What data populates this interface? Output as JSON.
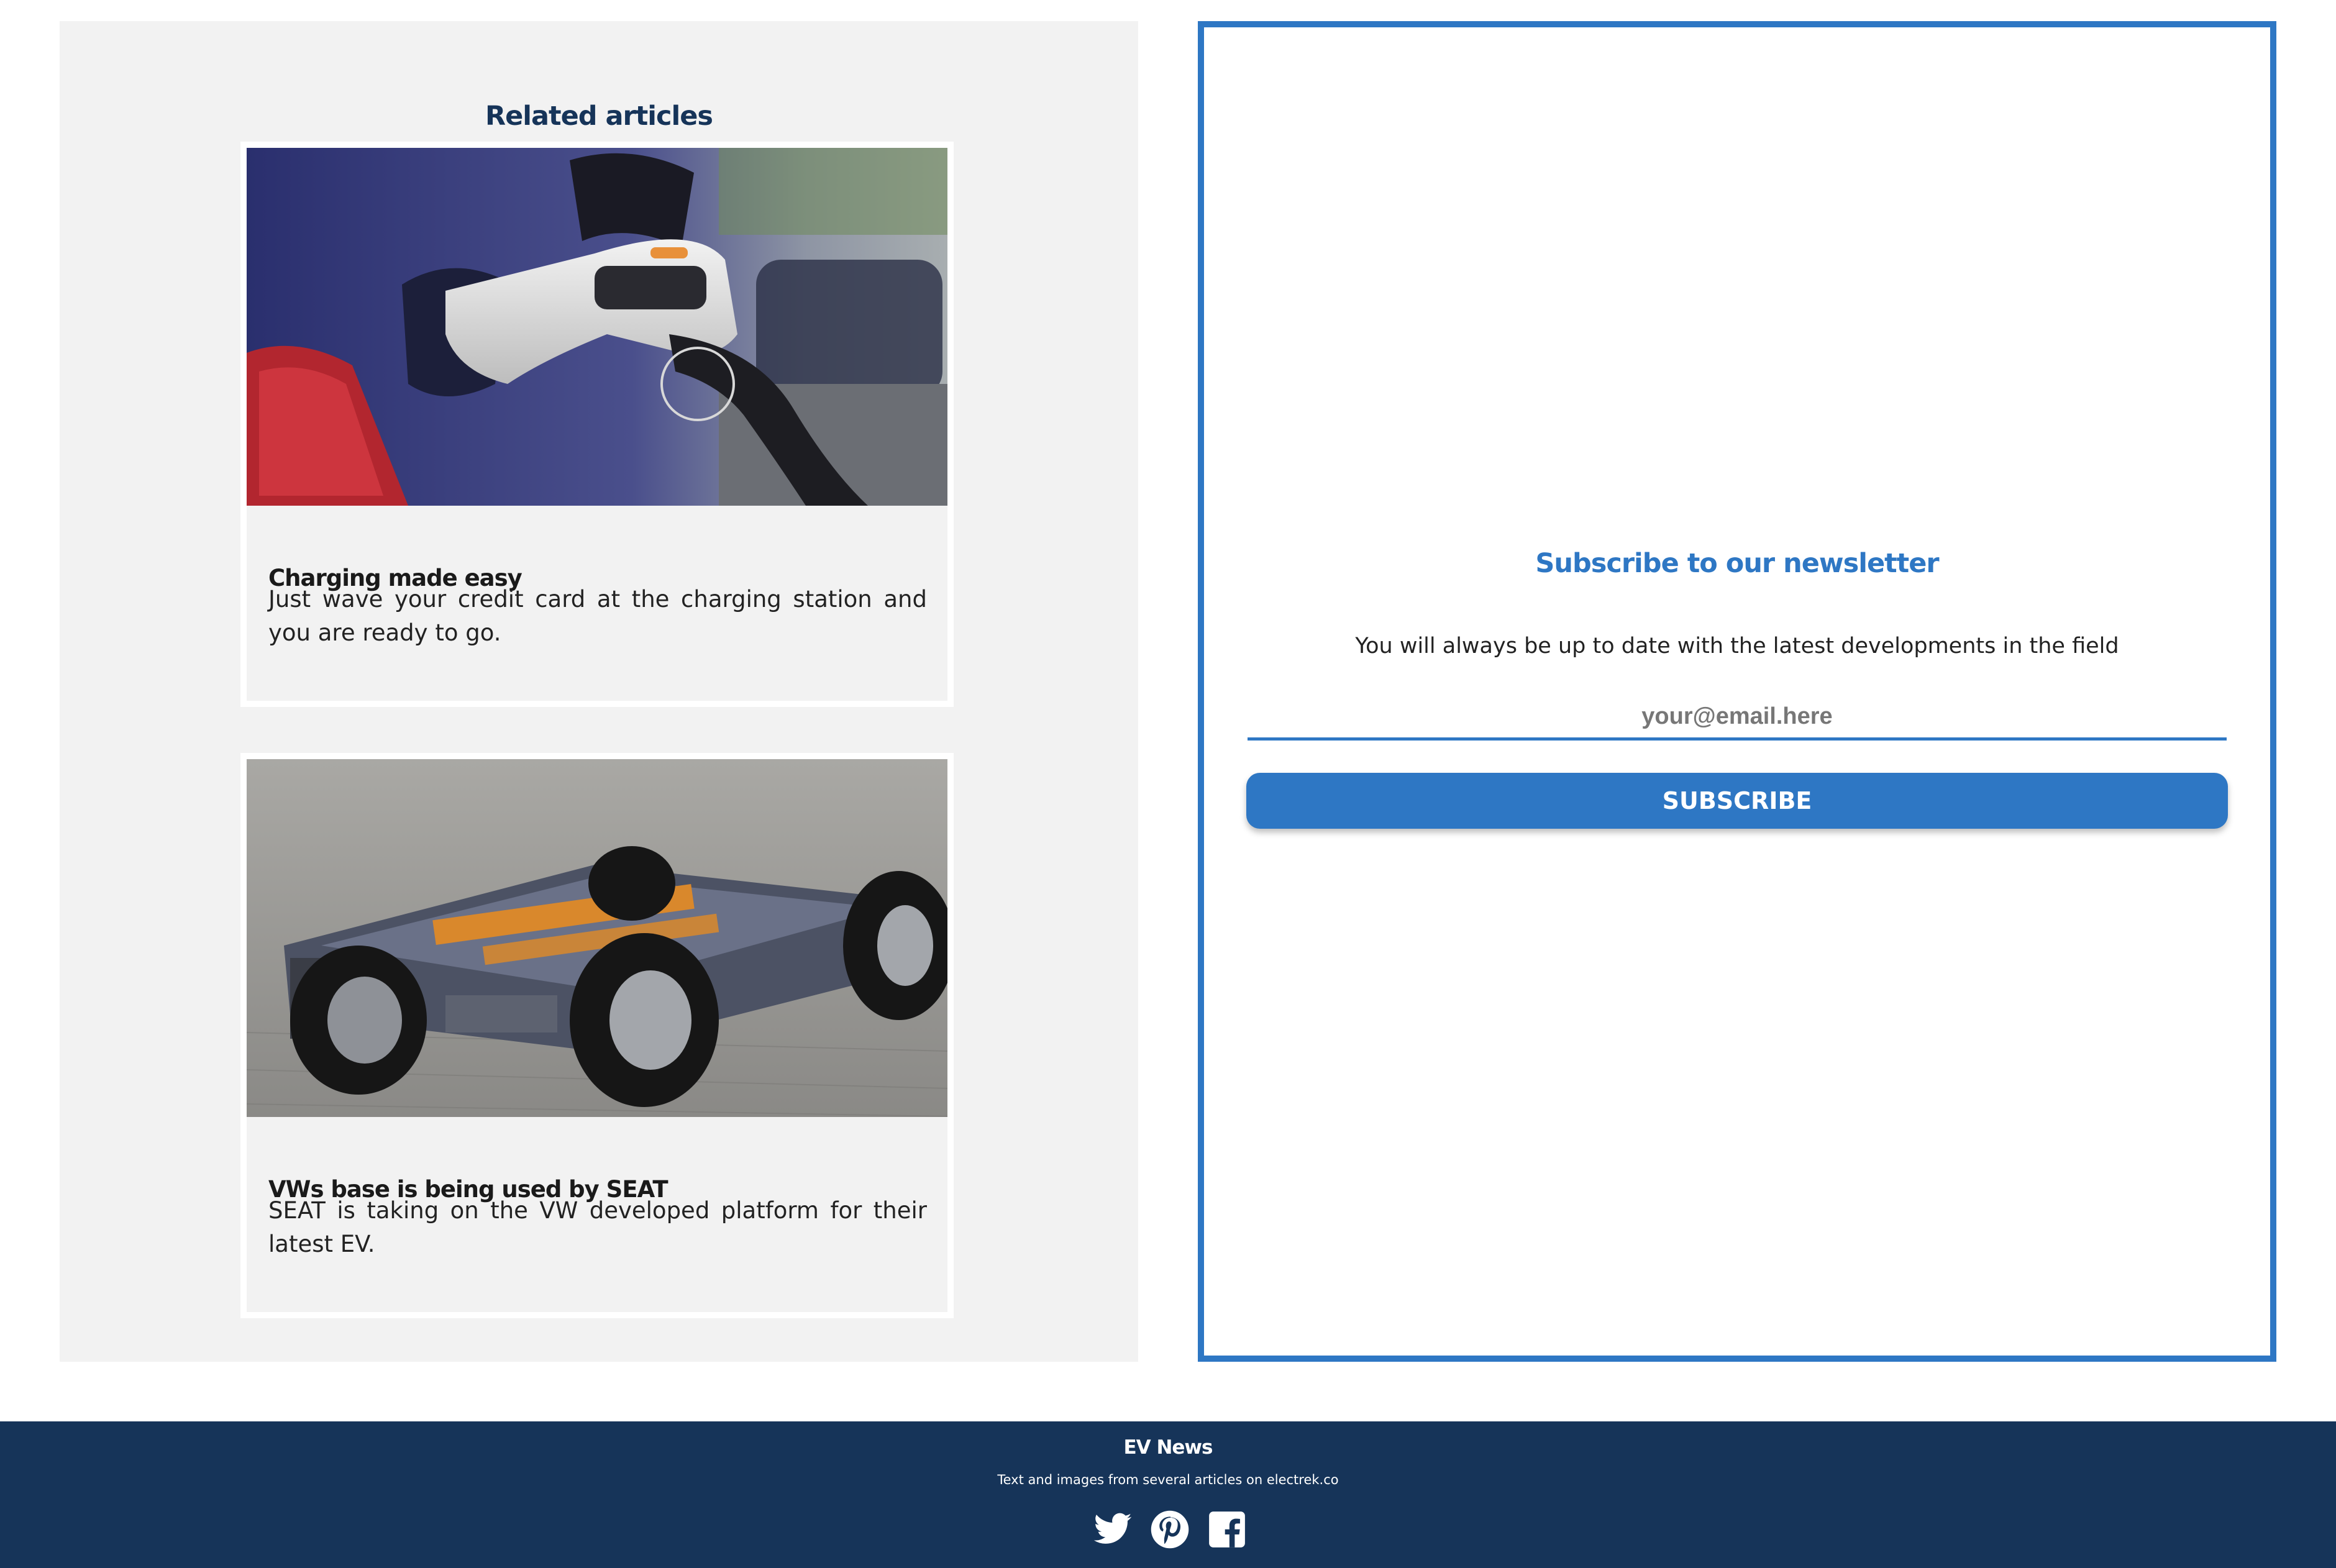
{
  "related": {
    "title": "Related articles",
    "articles": [
      {
        "title": "Charging made easy",
        "text": "Just wave your credit card at the charging station and you are ready to go."
      },
      {
        "title": "VWs base is being used by SEAT",
        "text": "SEAT is taking on the VW developed platform for their latest EV."
      }
    ]
  },
  "newsletter": {
    "title": "Subscribe to our newsletter",
    "text": "You will always be up to date with the latest developments in the field",
    "email_placeholder": "your@email.here",
    "button_label": "SUBSCRIBE"
  },
  "footer": {
    "brand": "EV News",
    "credit": "Text and images from several articles on electrek.co",
    "social_icons": [
      "twitter-icon",
      "pinterest-icon",
      "facebook-icon"
    ]
  },
  "colors": {
    "accent": "#2e77c4",
    "navy": "#163459",
    "panel_bg": "#f2f2f2"
  }
}
